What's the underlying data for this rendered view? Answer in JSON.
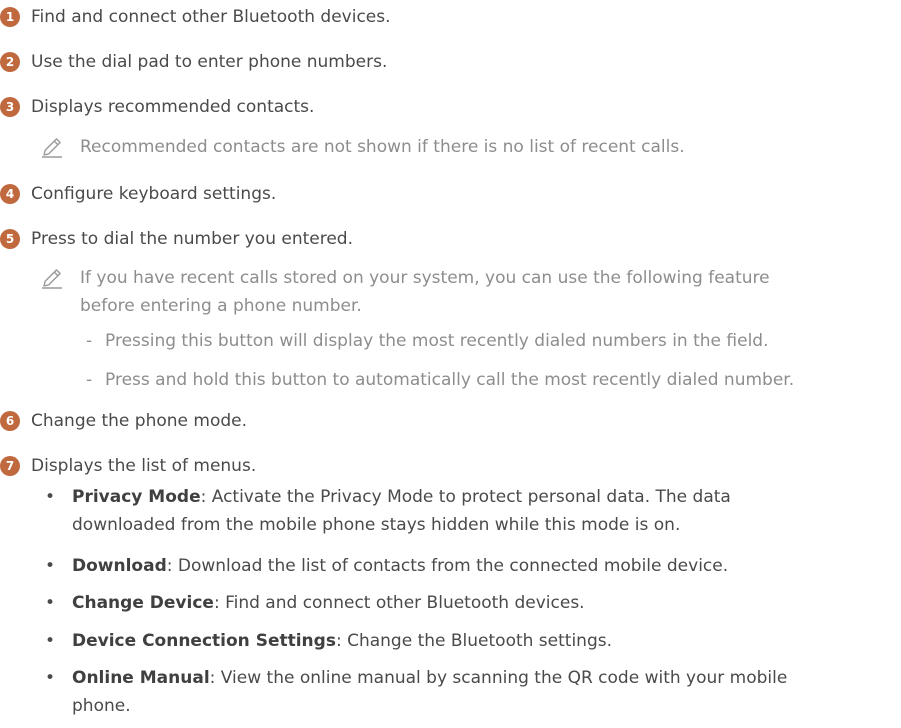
{
  "colors": {
    "badge": "#c0693f",
    "text": "#4a4a4a",
    "note": "#8d8d8d"
  },
  "items": [
    {
      "badge": "1",
      "text": "Find and connect other Bluetooth devices."
    },
    {
      "badge": "2",
      "text": "Use the dial pad to enter phone numbers."
    },
    {
      "badge": "3",
      "text": "Displays recommended contacts."
    },
    {
      "badge": "4",
      "text": "Configure keyboard settings."
    },
    {
      "badge": "5",
      "text": "Press to dial the number you entered."
    },
    {
      "badge": "6",
      "text": "Change the phone mode."
    },
    {
      "badge": "7",
      "text": "Displays the list of menus."
    }
  ],
  "notes": {
    "recommended": {
      "icon": "pencil-icon",
      "text": "Recommended contacts are not shown if there is no list of recent calls."
    },
    "recent_calls": {
      "icon": "pencil-icon",
      "line1": "If you have recent calls stored on your system, you can use the following feature",
      "line2": "before entering a phone number.",
      "subitems": [
        {
          "mark": "-",
          "text": "Pressing this button will display the most recently dialed numbers in the field."
        },
        {
          "mark": "-",
          "text": "Press and hold this button to automatically call the most recently dialed number."
        }
      ]
    }
  },
  "menus": [
    {
      "label": "Privacy Mode",
      "desc": ": Activate the Privacy Mode to protect personal data. The data",
      "desc2": "downloaded from the mobile phone stays hidden while this mode is on."
    },
    {
      "label": "Download",
      "desc": ": Download the list of contacts from the connected mobile device."
    },
    {
      "label": "Change Device",
      "desc": ": Find and connect other Bluetooth devices."
    },
    {
      "label": "Device Connection Settings",
      "desc": ": Change the Bluetooth settings."
    },
    {
      "label": "Online Manual",
      "desc": ": View the online manual by scanning the QR code with your mobile",
      "desc2": "phone."
    }
  ]
}
